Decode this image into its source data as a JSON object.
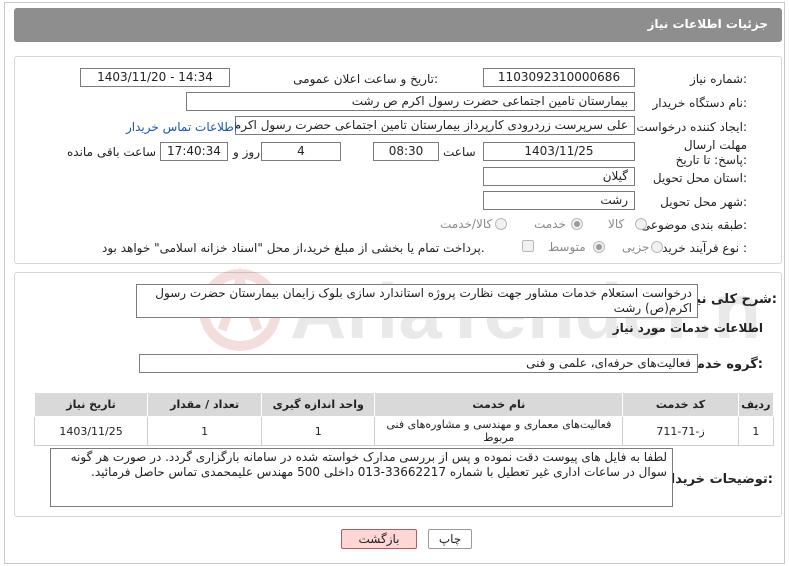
{
  "header": {
    "title": "جزئیات اطلاعات نیاز"
  },
  "form": {
    "need_number": {
      "label": "شماره نیاز:",
      "value": "1103092310000686"
    },
    "announce_datetime": {
      "label": "تاریخ و ساعت اعلان عمومی:",
      "value": "1403/11/20 - 14:34"
    },
    "buyer_org": {
      "label": "نام دستگاه خریدار:",
      "value": "بیمارستان  تامین اجتماعی حضرت رسول اکرم ص رشت"
    },
    "requester": {
      "label": "ایجاد کننده درخواست:",
      "value": "علی سرپرست زردرودی کارپرداز بیمارستان  تامین اجتماعی حضرت رسول اکرم ص",
      "contact_link": "اطلاعات تماس خریدار"
    },
    "deadline": {
      "label": "مهلت ارسال پاسخ: تا تاریخ:",
      "date": "1403/11/25",
      "time_label": "ساعت",
      "time": "08:30",
      "days": "4",
      "days_label": "روز و",
      "remaining_time": "17:40:34",
      "remaining_label": "ساعت باقی مانده"
    },
    "province": {
      "label": "استان محل تحویل:",
      "value": "گیلان"
    },
    "city": {
      "label": "شهر محل تحویل:",
      "value": "رشت"
    },
    "category": {
      "label": "طبقه بندی موضوعی:",
      "options": [
        "کالا",
        "خدمت",
        "کالا/خدمت"
      ],
      "selected": "خدمت"
    },
    "process_type": {
      "label": "نوع فرآیند خرید :",
      "options": [
        "جزیی",
        "متوسط"
      ],
      "selected": "متوسط",
      "payment_note": "پرداخت تمام یا بخشی از مبلغ خرید،از محل \"اسناد خزانه اسلامی\" خواهد بود."
    }
  },
  "details": {
    "summary_label": "شرح کلی نیاز:",
    "summary_text": "درخواست استعلام خدمات مشاور جهت نظارت پروژه استاندارد سازی بلوک زایمان بیمارستان حضرت رسول اکرم(ص) رشت",
    "services_heading": "اطلاعات خدمات مورد نیاز",
    "service_group_label": "گروه خدمت:",
    "service_group_value": "فعالیت‌های حرفه‌ای، علمی و فنی",
    "table": {
      "headers": [
        "ردیف",
        "کد خدمت",
        "نام خدمت",
        "واحد اندازه گیری",
        "تعداد / مقدار",
        "تاریخ نیاز"
      ],
      "rows": [
        [
          "1",
          "ز-71-711",
          "فعالیت‌های معماری و مهندسی و مشاوره‌های فنی مربوط",
          "1",
          "1",
          "1403/11/25"
        ]
      ]
    },
    "buyer_notes_label": "توضیحات خریدار:",
    "buyer_notes": "لطفا به فایل های پیوست دقت نموده و پس از بررسی مدارک خواسته شده در سامانه بارگزاری گردد. در صورت هر گونه سوال در ساعات اداری غیر تعطیل با شماره 33662217-013 داخلی 500 مهندس علیمحمدی تماس حاصل فرمائید."
  },
  "buttons": {
    "print": "چاپ",
    "back": "بازگشت"
  },
  "watermark": {
    "text": "AriaTender.neT"
  },
  "colors": {
    "header_bg": "#8e8e8e",
    "link": "#1a56b3",
    "back_button_bg": "#ffd6d6",
    "watermark": "#c0392b"
  }
}
